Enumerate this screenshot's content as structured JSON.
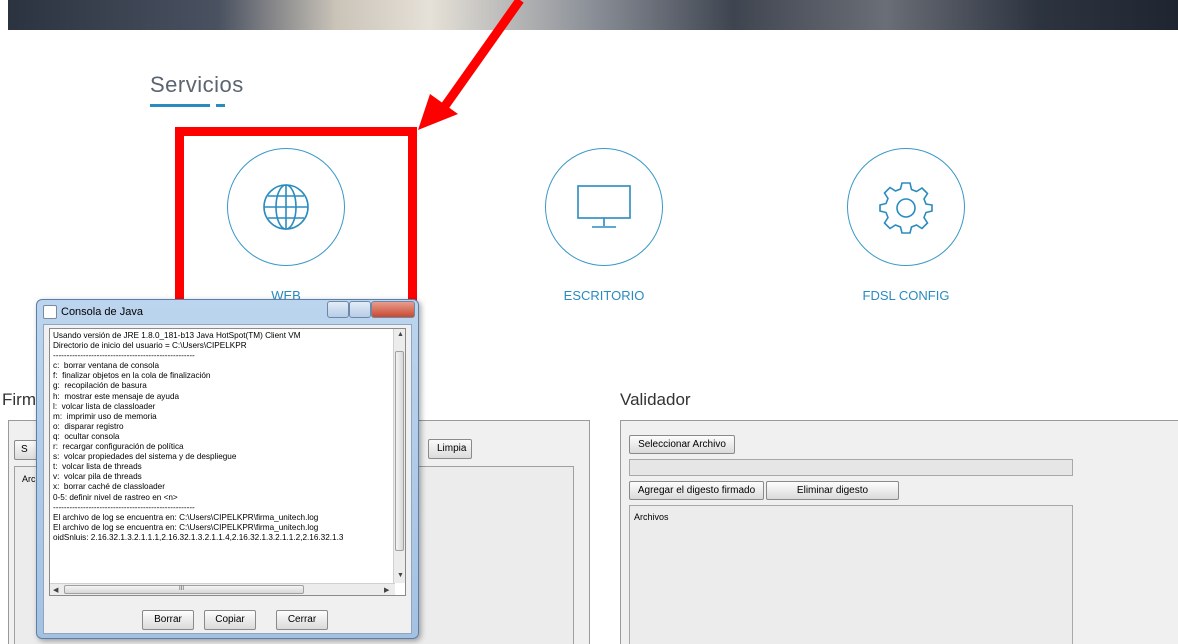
{
  "services": {
    "title": "Servicios",
    "items": [
      {
        "label": "WEB",
        "icon": "globe-icon"
      },
      {
        "label": "ESCRITORIO",
        "icon": "monitor-icon"
      },
      {
        "label": "FDSL CONFIG",
        "icon": "gear-icon"
      }
    ]
  },
  "colors": {
    "accent": "#2a8bbf",
    "highlight": "#ff0000"
  },
  "firmador": {
    "title": "Firm",
    "button_s": "S",
    "limpiar": "Limpia",
    "list_header": "Archi"
  },
  "validador": {
    "title": "Validador",
    "select_button": "Seleccionar Archivo",
    "add_button": "Agregar el digesto firmado",
    "remove_button": "Eliminar digesto",
    "list_header": "Archivos"
  },
  "console": {
    "window_title": "Consola de Java",
    "lines": [
      "Usando versión de JRE 1.8.0_181-b13 Java HotSpot(TM) Client VM",
      "Directorio de inicio del usuario = C:\\Users\\CIPELKPR",
      "----------------------------------------------------",
      "c:  borrar ventana de consola",
      "f:  finalizar objetos en la cola de finalización",
      "g:  recopilación de basura",
      "h:  mostrar este mensaje de ayuda",
      "l:  volcar lista de classloader",
      "m:  imprimir uso de memoria",
      "o:  disparar registro",
      "q:  ocultar consola",
      "r:  recargar configuración de política",
      "s:  volcar propiedades del sistema y de despliegue",
      "t:  volcar lista de threads",
      "v:  volcar pila de threads",
      "x:  borrar caché de classloader",
      "0-5: definir nivel de rastreo en <n>",
      "----------------------------------------------------",
      "El archivo de log se encuentra en: C:\\Users\\CIPELKPR\\firma_unitech.log",
      "El archivo de log se encuentra en: C:\\Users\\CIPELKPR\\firma_unitech.log",
      "oidSnluis: 2.16.32.1.3.2.1.1.1,2.16.32.1.3.2.1.1.4,2.16.32.1.3.2.1.1.2,2.16.32.1.3"
    ],
    "buttons": {
      "borrar": "Borrar",
      "copiar": "Copiar",
      "cerrar": "Cerrar"
    },
    "scroll_mark": "III"
  }
}
